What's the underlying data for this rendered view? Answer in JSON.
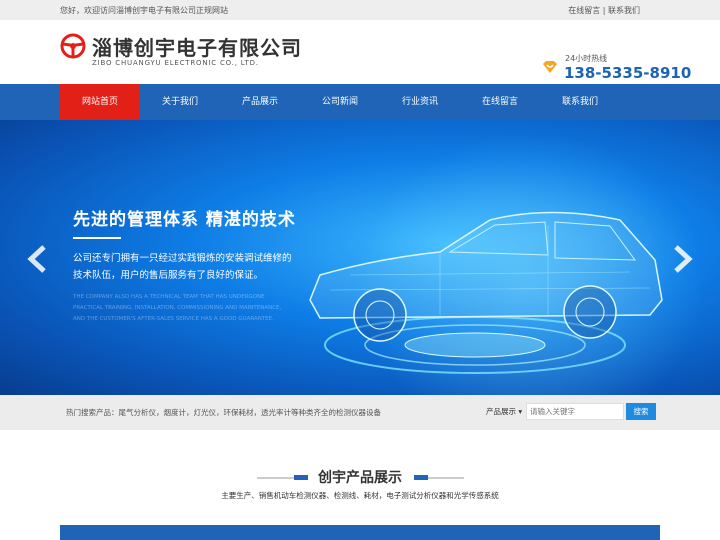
{
  "topbar": {
    "welcome": "您好，欢迎访问淄博创宇电子有限公司正规网站",
    "online_message": "在线留言",
    "separator": "|",
    "contact_us": "联系我们"
  },
  "header": {
    "company_name": "淄博创宇电子有限公司",
    "company_name_en": "ZIBO CHUANGYU ELECTRONIC  CO., LTD.",
    "hotline_label": "24小时热线",
    "hotline_number": "138-5335-8910",
    "logo_icon": "steering-wheel-icon",
    "hotline_icon": "diamond-heart-icon",
    "brand_red": "#e32018",
    "brand_blue": "#1f64b6"
  },
  "nav": {
    "items": [
      {
        "label": "网站首页",
        "active": true
      },
      {
        "label": "关于我们"
      },
      {
        "label": "产品展示"
      },
      {
        "label": "公司新闻"
      },
      {
        "label": "行业资讯"
      },
      {
        "label": "在线留言"
      },
      {
        "label": "联系我们"
      }
    ]
  },
  "banner": {
    "headline": "先进的管理体系 精湛的技术",
    "paragraph": "公司还专门拥有一只经过实践锻炼的安装调试维修的技术队伍，用户的售后服务有了良好的保证。",
    "paragraph_en": "THE COMPANY ALSO HAS A TECHNICAL TEAM THAT HAS UNDERGONE PRACTICAL TRAINING, INSTALLATION, COMMISSIONING AND MAINTENANCE, AND THE CUSTOMER'S AFTER-SALES SERVICE HAS A GOOD GUARANTEE.",
    "prev_icon": "chevron-left-icon",
    "next_icon": "chevron-right-icon"
  },
  "search": {
    "hot_products": "热门搜索产品：尾气分析仪，烟度计，灯光仪，环保耗材，透光率计等种类齐全的检测仪器设备",
    "category": "产品展示",
    "category_icon": "caret-down-icon",
    "placeholder": "请输入关键字",
    "button": "搜索"
  },
  "products_section": {
    "title": "创宇产品展示",
    "subtitle": "主要生产、销售机动车检测仪器、检测线、耗材，电子测试分析仪器和光学传感系统"
  }
}
